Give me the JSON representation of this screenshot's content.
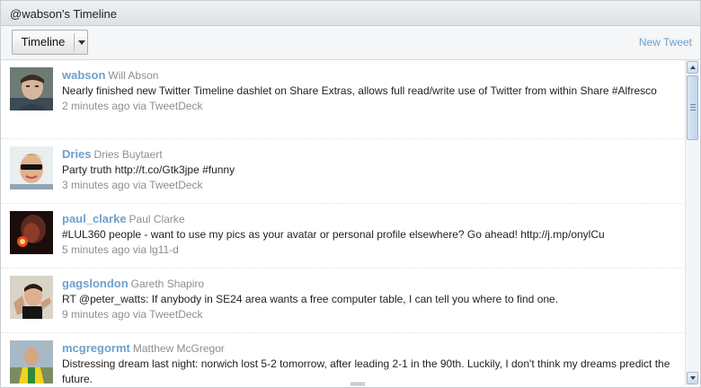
{
  "dashlet": {
    "title": "@wabson's Timeline",
    "timeline_button": "Timeline",
    "new_tweet_label": "New Tweet"
  },
  "tweets": [
    {
      "username": "wabson",
      "fullname": "Will Abson",
      "text": "Nearly finished new Twitter Timeline dashlet on Share Extras, allows full read/write use of Twitter from within Share #Alfresco",
      "meta": "2 minutes ago via TweetDeck"
    },
    {
      "username": "Dries",
      "fullname": "Dries Buytaert",
      "text": "Party truth http://t.co/Gtk3jpe #funny",
      "meta": "3 minutes ago via TweetDeck"
    },
    {
      "username": "paul_clarke",
      "fullname": "Paul Clarke",
      "text": "#LUL360 people - want to use my pics as your avatar or personal profile elsewhere? Go ahead! http://j.mp/onylCu",
      "meta": "5 minutes ago via lg11-d"
    },
    {
      "username": "gagslondon",
      "fullname": "Gareth Shapiro",
      "text": "RT @peter_watts: If anybody in SE24 area wants a free computer table, I can tell you where to find one.",
      "meta": "9 minutes ago via TweetDeck"
    },
    {
      "username": "mcgregormt",
      "fullname": "Matthew McGregor",
      "text": "Distressing dream last night: norwich lost 5-2 tomorrow, after leading 2-1 in the 90th. Luckily, I don't think my dreams predict the future.",
      "meta": ""
    }
  ]
}
